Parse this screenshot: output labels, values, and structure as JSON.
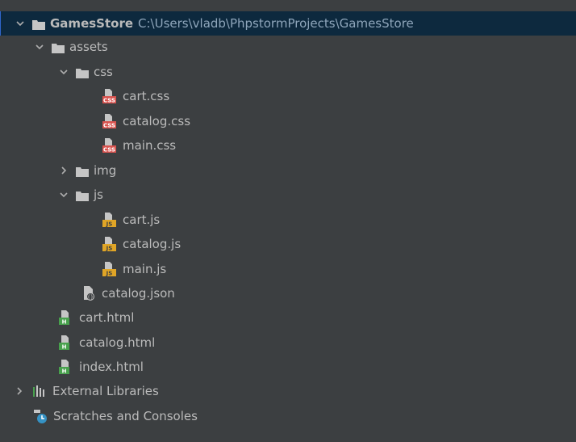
{
  "tree": {
    "root": {
      "name": "GamesStore",
      "path": "C:\\Users\\vladb\\PhpstormProjects\\GamesStore",
      "expanded": true
    },
    "items": [
      {
        "label": "assets",
        "kind": "folder",
        "expanded": true
      },
      {
        "label": "css",
        "kind": "folder",
        "expanded": true
      },
      {
        "label": "cart.css",
        "kind": "css"
      },
      {
        "label": "catalog.css",
        "kind": "css"
      },
      {
        "label": "main.css",
        "kind": "css"
      },
      {
        "label": "img",
        "kind": "folder",
        "expanded": false
      },
      {
        "label": "js",
        "kind": "folder",
        "expanded": true
      },
      {
        "label": "cart.js",
        "kind": "js"
      },
      {
        "label": "catalog.js",
        "kind": "js"
      },
      {
        "label": "main.js",
        "kind": "js"
      },
      {
        "label": "catalog.json",
        "kind": "json"
      },
      {
        "label": "cart.html",
        "kind": "html"
      },
      {
        "label": "catalog.html",
        "kind": "html"
      },
      {
        "label": "index.html",
        "kind": "html"
      },
      {
        "label": "External Libraries",
        "kind": "libraries",
        "expanded": false
      },
      {
        "label": "Scratches and Consoles",
        "kind": "scratches"
      }
    ]
  },
  "colors": {
    "background": "#3c3f41",
    "selection": "#0d293e",
    "text": "#bbbbbb",
    "path_text": "#8fa6bb",
    "folder": "#c5c5c5",
    "css_badge": "#d9534f",
    "js_badge": "#e0a526",
    "html_badge": "#48a14d"
  }
}
